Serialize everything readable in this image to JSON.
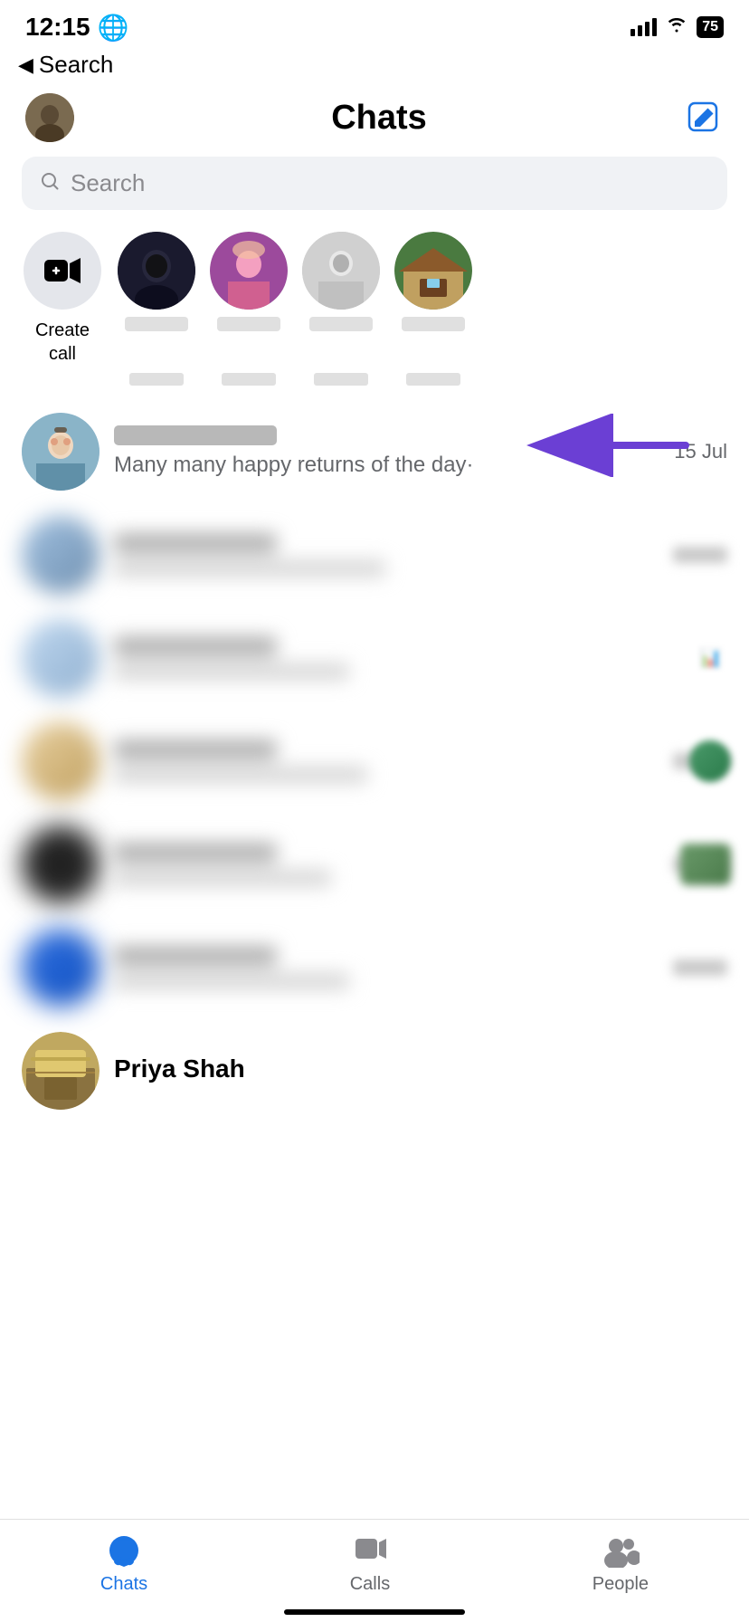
{
  "statusBar": {
    "time": "12:15",
    "globeIcon": "🌐",
    "battery": "75"
  },
  "backNav": {
    "arrow": "◀",
    "label": "Search"
  },
  "header": {
    "title": "Chats",
    "compose_tooltip": "New message"
  },
  "searchBar": {
    "placeholder": "Search"
  },
  "createCall": {
    "label": "Create\ncall"
  },
  "stories": [
    {
      "id": 1,
      "colorClass": "avatar-dark"
    },
    {
      "id": 2,
      "colorClass": "avatar-pink"
    },
    {
      "id": 3,
      "colorClass": "avatar-mono"
    },
    {
      "id": 4,
      "colorClass": "avatar-orange"
    }
  ],
  "firstChat": {
    "name": "...",
    "preview": "Many many happy returns of the day·",
    "time": "15 Jul"
  },
  "blurredChats": [
    {
      "id": 1
    },
    {
      "id": 2
    },
    {
      "id": 3
    },
    {
      "id": 4
    },
    {
      "id": 5
    }
  ],
  "lastChatName": "Priya Shah",
  "tabBar": {
    "tabs": [
      {
        "id": "chats",
        "label": "Chats",
        "active": true
      },
      {
        "id": "calls",
        "label": "Calls",
        "active": false
      },
      {
        "id": "people",
        "label": "People",
        "active": false
      }
    ]
  }
}
